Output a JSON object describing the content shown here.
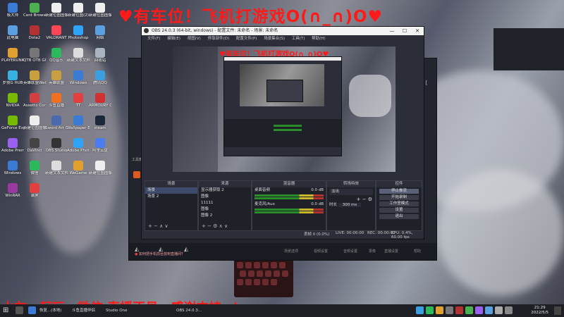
{
  "overlay": {
    "top_text": "♥有车位！飞机打游戏O(∩_∩)O♥",
    "bottom_text": "水友一起玩，微信 直播不易，感谢支持~！"
  },
  "desktop_icons": [
    {
      "label": "极大师",
      "color": "#3a7bd5"
    },
    {
      "label": "Cent Browser",
      "color": "#4caf50"
    },
    {
      "label": "新建位图图像",
      "color": "#eeeeee"
    },
    {
      "label": "新建位图(2)",
      "color": "#eeeeee"
    },
    {
      "label": "新建位图图像",
      "color": "#eeeeee"
    },
    {
      "label": "此电脑",
      "color": "#5aa0e0"
    },
    {
      "label": "Dota2",
      "color": "#b23232"
    },
    {
      "label": "VALORANT",
      "color": "#ff4655"
    },
    {
      "label": "Photoshop",
      "color": "#2fa3f7"
    },
    {
      "label": "网络",
      "color": "#5aa0e0"
    },
    {
      "label": "PLAYERUNKNOWN BATTLEGROUNDS",
      "color": "#e0a030"
    },
    {
      "label": "QTB OTB GUI",
      "color": "#777777"
    },
    {
      "label": "QQ音乐",
      "color": "#2eb85c"
    },
    {
      "label": "新建文本文档",
      "color": "#dddddd"
    },
    {
      "label": "回收站",
      "color": "#aab4c0"
    },
    {
      "label": "罗技G HUB",
      "color": "#3ab0e0"
    },
    {
      "label": "英雄联盟WeGame",
      "color": "#c8a040"
    },
    {
      "label": "英雄联盟",
      "color": "#c8a040"
    },
    {
      "label": "Windows",
      "color": "#3a7bd5"
    },
    {
      "label": "腾讯QQ",
      "color": "#3a9ee0"
    },
    {
      "label": "NVIDIA",
      "color": "#76b900"
    },
    {
      "label": "Assetto Corsa",
      "color": "#d04040"
    },
    {
      "label": "斗鱼直播",
      "color": "#f07020"
    },
    {
      "label": "TT",
      "color": "#e04040"
    },
    {
      "label": "ARMOURY CRATE",
      "color": "#d03030"
    },
    {
      "label": "GeForce Experience",
      "color": "#76b900"
    },
    {
      "label": "新建位图图像",
      "color": "#eeeeee"
    },
    {
      "label": "Sword Art Online",
      "color": "#4a6ab0"
    },
    {
      "label": "Wallpaper Engine",
      "color": "#3a7bd5"
    },
    {
      "label": "steam",
      "color": "#1b2838"
    },
    {
      "label": "Adobe Premiere",
      "color": "#9a60f0"
    },
    {
      "label": "DaVinci",
      "color": "#444444"
    },
    {
      "label": "OBS Studio",
      "color": "#333333"
    },
    {
      "label": "Adobe Photoshop",
      "color": "#2fa3f7"
    },
    {
      "label": "阿里云盘",
      "color": "#4a7ef0"
    },
    {
      "label": "Windows",
      "color": "#3a7bd5"
    },
    {
      "label": "微信",
      "color": "#2eb85c"
    },
    {
      "label": "新建文本文档",
      "color": "#dddddd"
    },
    {
      "label": "WeGame",
      "color": "#e0a030"
    },
    {
      "label": "新建位图图像",
      "color": "#eeeeee"
    },
    {
      "label": "WinRAR",
      "color": "#9a3aa0"
    },
    {
      "label": "录屏",
      "color": "#e04040"
    }
  ],
  "obs": {
    "title": "OBS 24.0.3 (64-bit, windows) - 配置文件: 未命名 - 场景: 未命名",
    "menu": [
      "文件(F)",
      "编辑(E)",
      "视图(V)",
      "停靠部件(D)",
      "配置文件(P)",
      "场景集合(S)",
      "工具(T)",
      "帮助(H)"
    ],
    "minimize": "—",
    "maximize": "☐",
    "close": "✕",
    "docks": {
      "scenes": {
        "title": "场景",
        "items": [
          "场景",
          "场景 2"
        ]
      },
      "sources": {
        "title": "来源",
        "items": [
          "显示器获取 2",
          "图像",
          "11111",
          "图像",
          "图像 2"
        ]
      },
      "mixer": {
        "title": "混音器",
        "channels": [
          {
            "name": "桌面音频",
            "db": "0.0 dB"
          },
          {
            "name": "麦克风/Aux",
            "db": "0.0 dB"
          }
        ]
      },
      "transitions": {
        "title": "转场特效",
        "type": "淡出",
        "duration_label": "时长",
        "duration": "300 ms"
      },
      "controls": {
        "title": "控件",
        "buttons": [
          "停止推流",
          "开始录制",
          "工作室模式",
          "设置",
          "退出"
        ]
      }
    },
    "statusbar": {
      "drop": "丢帧 0 (0.0%)",
      "live": "LIVE: 00:00:00",
      "rec": "REC: 00:00:00",
      "cpu": "CPU: 0.4%, 60.00 fps"
    }
  },
  "overlay_window": {
    "notice": "如何把手机前台放到直播间？",
    "tools": [
      "场景选项",
      "视频设置",
      "音频设置",
      "录像",
      "直播设置",
      "帮助"
    ]
  },
  "taskbar": {
    "items": [
      "恢复...(本地)",
      "斗鱼直播伴侣",
      "Studio One",
      "OBS 24.0.3..."
    ],
    "time": "21:29",
    "date": "2022/5/5"
  }
}
